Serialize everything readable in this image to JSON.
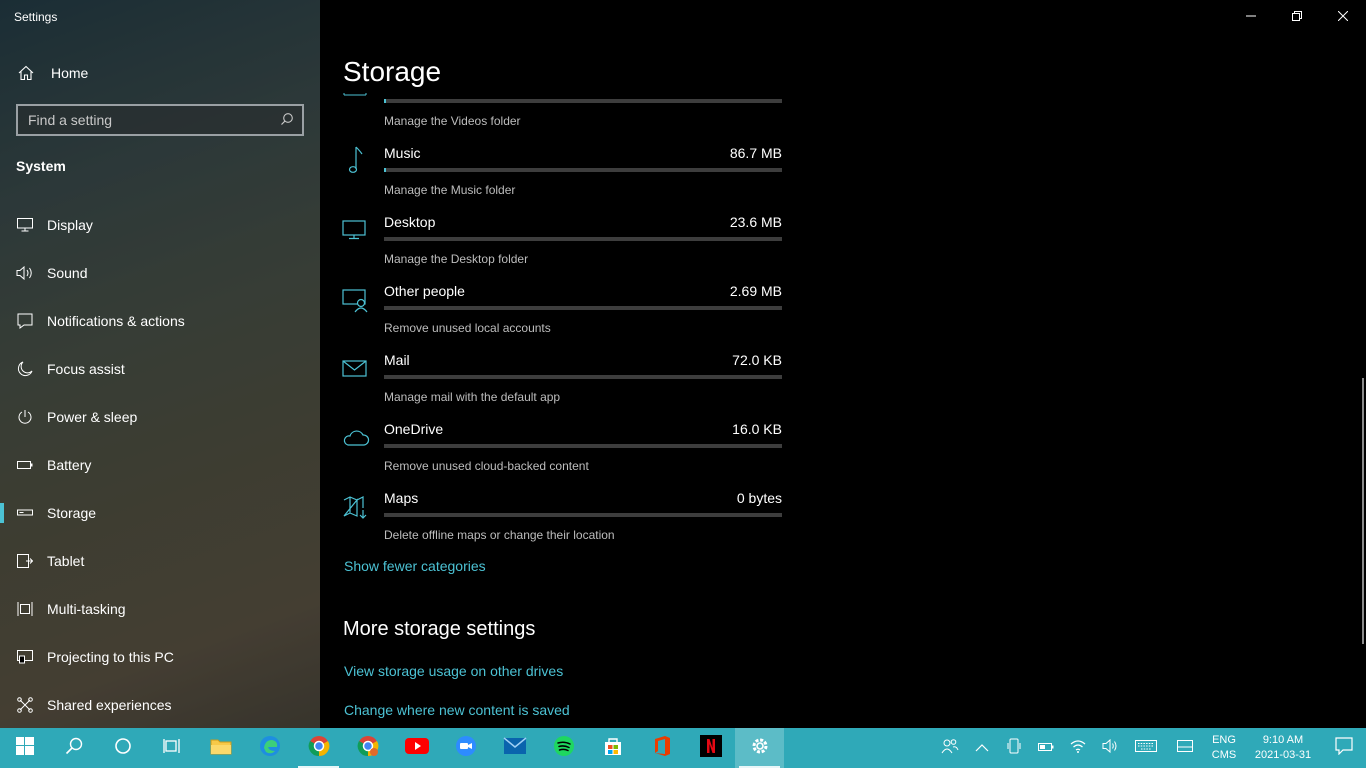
{
  "window": {
    "title": "Settings"
  },
  "sidebar": {
    "home_label": "Home",
    "search_placeholder": "Find a setting",
    "section": "System",
    "items": [
      {
        "label": "Display",
        "icon": "display-icon"
      },
      {
        "label": "Sound",
        "icon": "sound-icon"
      },
      {
        "label": "Notifications & actions",
        "icon": "notifications-icon"
      },
      {
        "label": "Focus assist",
        "icon": "moon-icon"
      },
      {
        "label": "Power & sleep",
        "icon": "power-icon"
      },
      {
        "label": "Battery",
        "icon": "battery-icon"
      },
      {
        "label": "Storage",
        "icon": "storage-icon",
        "active": true
      },
      {
        "label": "Tablet",
        "icon": "tablet-icon"
      },
      {
        "label": "Multi-tasking",
        "icon": "multitasking-icon"
      },
      {
        "label": "Projecting to this PC",
        "icon": "projecting-icon"
      },
      {
        "label": "Shared experiences",
        "icon": "shared-experiences-icon"
      }
    ]
  },
  "main": {
    "title": "Storage",
    "categories": [
      {
        "name": "",
        "size": "",
        "description": "Manage the Videos folder",
        "icon": "video-icon",
        "usage": 0.005
      },
      {
        "name": "Music",
        "size": "86.7 MB",
        "description": "Manage the Music folder",
        "icon": "music-icon",
        "usage": 0.005
      },
      {
        "name": "Desktop",
        "size": "23.6 MB",
        "description": "Manage the Desktop folder",
        "icon": "desktop-icon",
        "usage": 0.0
      },
      {
        "name": "Other people",
        "size": "2.69 MB",
        "description": "Remove unused local accounts",
        "icon": "other-people-icon",
        "usage": 0.0
      },
      {
        "name": "Mail",
        "size": "72.0 KB",
        "description": "Manage mail with the default app",
        "icon": "mail-icon",
        "usage": 0.0
      },
      {
        "name": "OneDrive",
        "size": "16.0 KB",
        "description": "Remove unused cloud-backed content",
        "icon": "onedrive-icon",
        "usage": 0.0
      },
      {
        "name": "Maps",
        "size": "0 bytes",
        "description": "Delete offline maps or change their location",
        "icon": "maps-icon",
        "usage": 0.0
      }
    ],
    "show_fewer": "Show fewer categories",
    "more_heading": "More storage settings",
    "link_other_drives": "View storage usage on other drives",
    "link_new_content": "Change where new content is saved"
  },
  "taskbar": {
    "apps": [
      "start-icon",
      "search-icon",
      "cortana-icon",
      "task-view-icon",
      "file-explorer-icon",
      "edge-icon",
      "chrome-icon",
      "chrome-profile-icon",
      "youtube-icon",
      "zoom-icon",
      "mail-app-icon",
      "spotify-icon",
      "store-icon",
      "office-icon",
      "netflix-icon",
      "settings-icon"
    ],
    "lang_top": "ENG",
    "lang_bottom": "CMS",
    "time": "9:10 AM",
    "date": "2021-03-31"
  },
  "colors": {
    "accent": "#4cc2d4",
    "taskbar": "#2fa9b8"
  }
}
